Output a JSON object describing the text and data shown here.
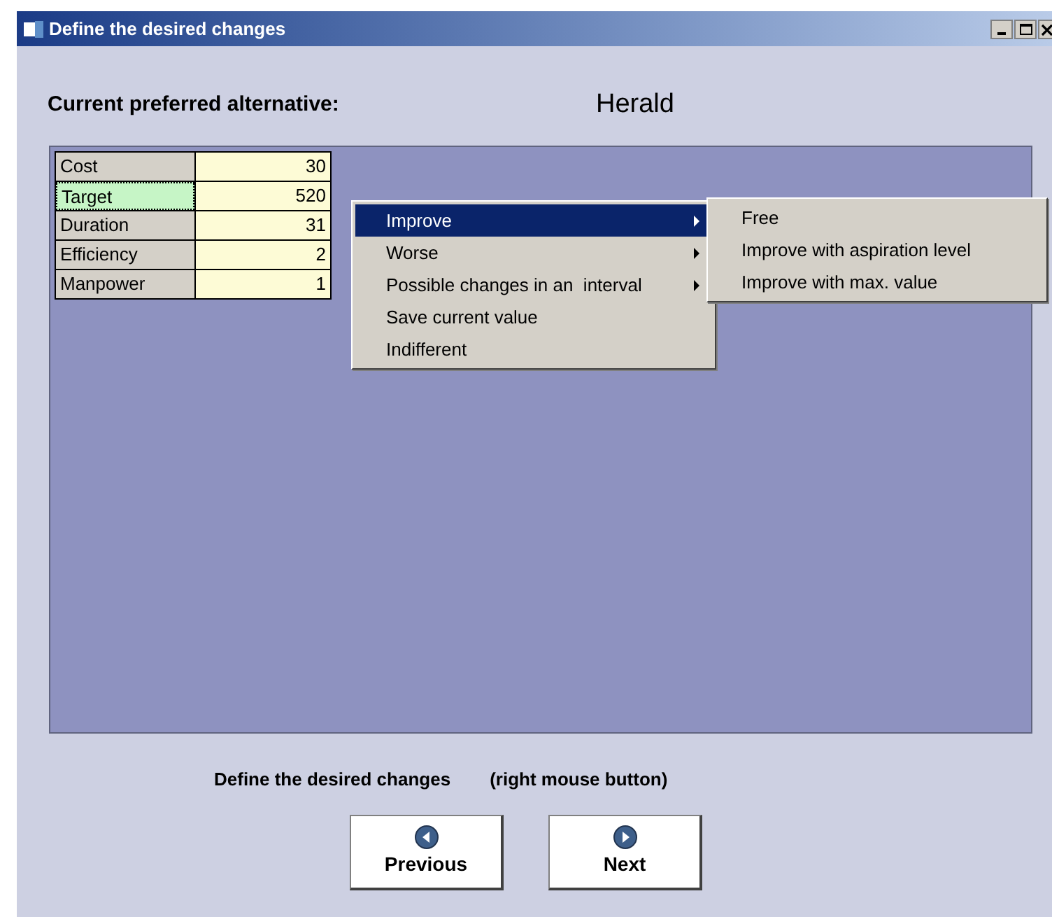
{
  "window": {
    "title": "Define the desired changes"
  },
  "header": {
    "label": "Current preferred alternative:",
    "value": "Herald"
  },
  "criteria": [
    {
      "name": "Cost",
      "value": "30",
      "selected": false
    },
    {
      "name": "Target",
      "value": "520",
      "selected": true
    },
    {
      "name": "Duration",
      "value": "31",
      "selected": false
    },
    {
      "name": "Efficiency",
      "value": "2",
      "selected": false
    },
    {
      "name": "Manpower",
      "value": "1",
      "selected": false
    }
  ],
  "context_menu": [
    {
      "label": "Improve",
      "submenu": true,
      "selected": true
    },
    {
      "label": "Worse",
      "submenu": true,
      "selected": false
    },
    {
      "label": "Possible changes in an  interval",
      "submenu": true,
      "selected": false
    },
    {
      "label": "Save current value",
      "submenu": false,
      "selected": false
    },
    {
      "label": "Indifferent",
      "submenu": false,
      "selected": false
    }
  ],
  "submenu": [
    {
      "label": "Free"
    },
    {
      "label": "Improve with aspiration level"
    },
    {
      "label": "Improve with max. value"
    }
  ],
  "hint": {
    "text": "Define the desired changes",
    "note": "(right  mouse button)"
  },
  "buttons": [
    {
      "kind": "previous",
      "label": "Previous"
    },
    {
      "kind": "next",
      "label": "Next"
    }
  ]
}
